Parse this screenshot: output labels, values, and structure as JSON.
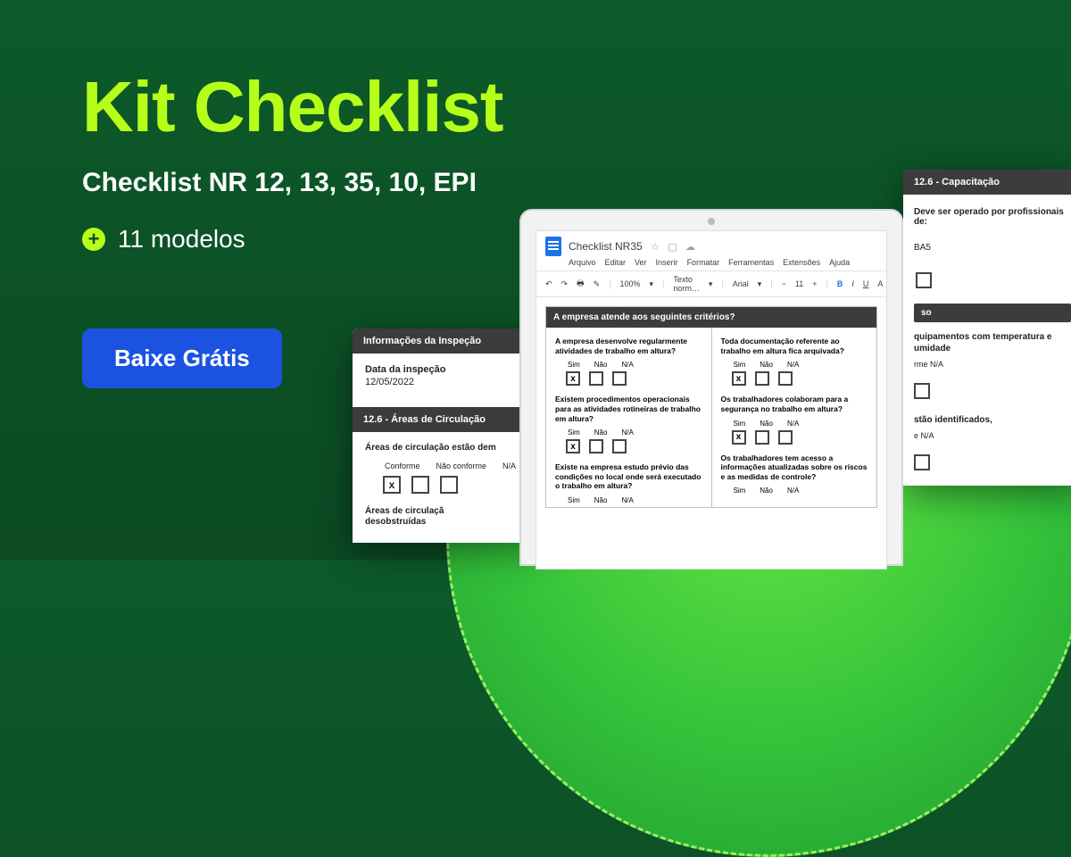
{
  "hero": {
    "title": "Kit Checklist",
    "subtitle": "Checklist NR 12, 13, 35, 10, EPI",
    "models_count": "11 modelos",
    "plus_glyph": "+"
  },
  "cta": {
    "label": "Baixe Grátis"
  },
  "card_left": {
    "header1": "Informações da Inspeção",
    "date_label": "Data da inspeção",
    "date_value": "12/05/2022",
    "header2": "12.6  - Áreas de Circulação",
    "q1": "Áreas de circulação estão dem",
    "opts": [
      "Conforme",
      "Não conforme",
      "N/A"
    ],
    "q2_l1": "Áreas de circulaçã",
    "q2_l2": "desobstruídas",
    "mark": "x"
  },
  "card_right": {
    "header": "12.6  - Capacitação",
    "q1": "Deve ser operado por profissionais de:",
    "ba5": "BA5",
    "so": "so",
    "line1": "quipamentos com temperatura e umidade",
    "opts_tail": "rme  N/A",
    "line2": "stão identificados,",
    "opts_tail2": "e  N/A"
  },
  "laptop": {
    "doc_title": "Checklist NR35",
    "menu": [
      "Arquivo",
      "Editar",
      "Ver",
      "Inserir",
      "Formatar",
      "Ferramentas",
      "Extensões",
      "Ajuda"
    ],
    "toolbar": {
      "zoom": "100%",
      "style": "Texto norm…",
      "font": "Arial",
      "size": "11"
    },
    "page_header": "A empresa atende aos seguintes critérios?",
    "opts": [
      "Sim",
      "Não",
      "N/A"
    ],
    "mark": "x",
    "left_qs": [
      "A empresa desenvolve regularmente atividades de trabalho em altura?",
      "Existem procedimentos operacionais para as atividades rotineiras de trabalho em altura?",
      "Existe na empresa estudo prévio das condições no local onde será executado o trabalho em altura?"
    ],
    "right_qs": [
      "Toda documentação referente ao trabalho em altura fica arquivada?",
      "Os trabalhadores colaboram para a segurança no trabalho em altura?",
      "Os trabalhadores tem acesso a informações atualizadas sobre os riscos e as medidas de controle?"
    ]
  }
}
